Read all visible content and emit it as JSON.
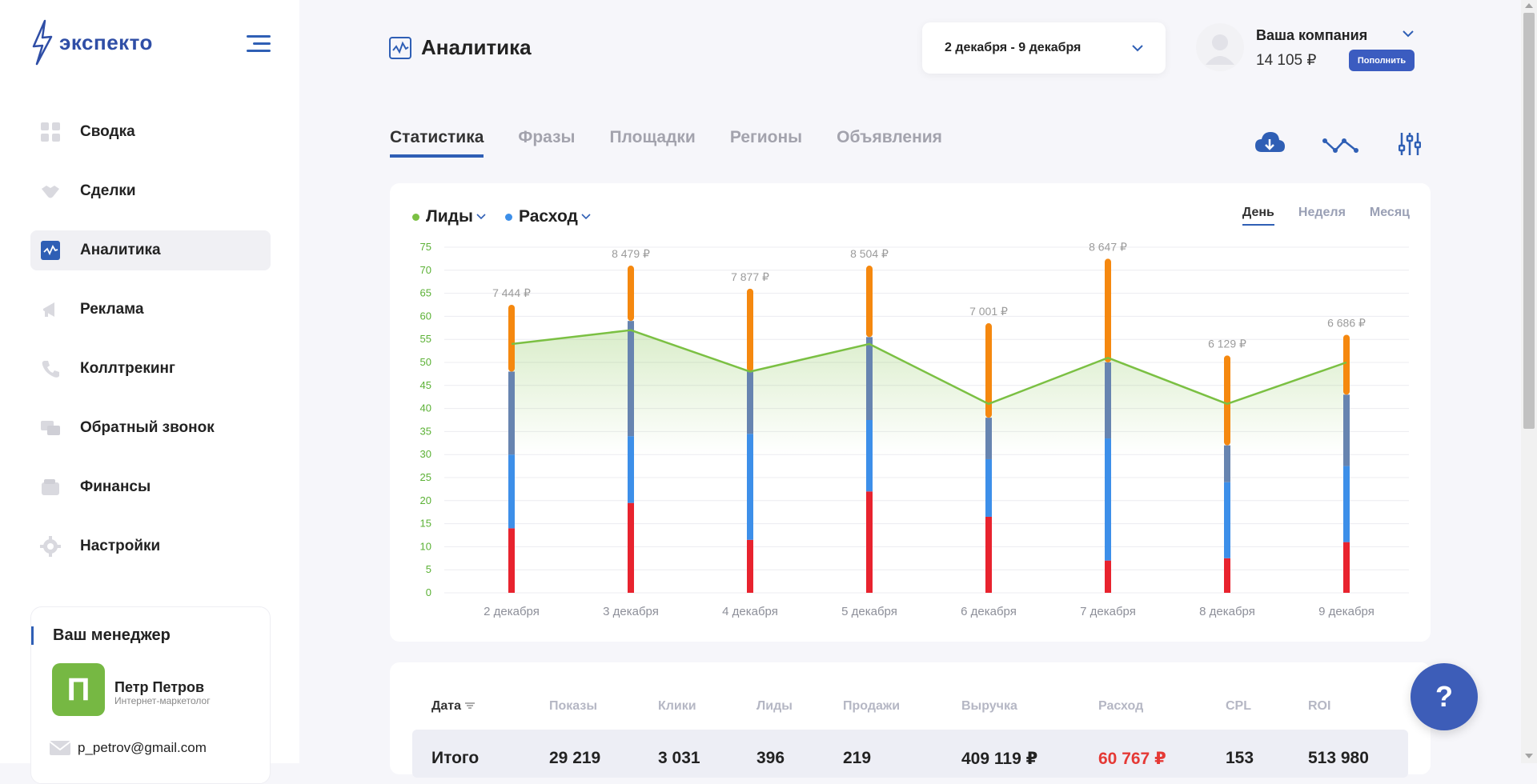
{
  "app": {
    "logo_text": "экспекто"
  },
  "sidebar": {
    "items": [
      {
        "label": "Сводка",
        "icon": "dashboard-icon"
      },
      {
        "label": "Сделки",
        "icon": "handshake-icon"
      },
      {
        "label": "Аналитика",
        "icon": "analytics-icon",
        "active": true
      },
      {
        "label": "Реклама",
        "icon": "megaphone-icon"
      },
      {
        "label": "Коллтрекинг",
        "icon": "phone-icon"
      },
      {
        "label": "Обратный звонок",
        "icon": "callback-icon"
      },
      {
        "label": "Финансы",
        "icon": "wallet-icon"
      },
      {
        "label": "Настройки",
        "icon": "gear-icon"
      }
    ],
    "manager": {
      "title": "Ваш менеджер",
      "initial": "П",
      "name": "Петр Петров",
      "role": "Интернет-маркетолог",
      "email": "p_petrov@gmail.com"
    }
  },
  "header": {
    "title": "Аналитика",
    "date_range": "2 декабря - 9 декабря",
    "company": "Ваша компания",
    "balance": "14 105 ₽",
    "topup_label": "Пополнить"
  },
  "tabs": [
    "Статистика",
    "Фразы",
    "Площадки",
    "Регионы",
    "Объявления"
  ],
  "chart_controls": {
    "metric1": "Лиды",
    "metric2": "Расход",
    "periods": [
      "День",
      "Неделя",
      "Месяц"
    ]
  },
  "colors": {
    "accent": "#2f5fb5",
    "leads_line": "#7bc043",
    "seg_red": "#e8232e",
    "seg_blue": "#3d8fe9",
    "seg_steel": "#6784b0",
    "seg_orange": "#f5880f",
    "axis_label": "#5bb135"
  },
  "chart_data": {
    "type": "bar",
    "ylim": [
      0,
      75
    ],
    "yticks": [
      0,
      5,
      10,
      15,
      20,
      25,
      30,
      35,
      40,
      45,
      50,
      55,
      60,
      65,
      70,
      75
    ],
    "categories": [
      "2 декабря",
      "3 декабря",
      "4 декабря",
      "5 декабря",
      "6 декабря",
      "7 декабря",
      "8 декабря",
      "9 декабря"
    ],
    "stack_boundaries": [
      [
        14,
        30,
        48,
        62.5
      ],
      [
        19.5,
        34,
        59,
        71
      ],
      [
        11.5,
        34.5,
        48,
        66
      ],
      [
        22,
        37.5,
        55.5,
        71
      ],
      [
        16.5,
        29,
        38,
        58.5
      ],
      [
        7,
        33.5,
        50,
        72.5
      ],
      [
        7.5,
        24,
        32,
        51.5
      ],
      [
        11,
        27.5,
        43,
        56
      ]
    ],
    "bar_labels": [
      "7 444 ₽",
      "8 479 ₽",
      "7 877 ₽",
      "8 504 ₽",
      "7 001 ₽",
      "8 647 ₽",
      "6 129 ₽",
      "6 686 ₽"
    ],
    "series": [
      {
        "name": "Лиды",
        "type": "line",
        "values": [
          54,
          57,
          48,
          54,
          41,
          51,
          41,
          50
        ]
      }
    ]
  },
  "table": {
    "headers": [
      "Дата",
      "Показы",
      "Клики",
      "Лиды",
      "Продажи",
      "Выручка",
      "Расход",
      "CPL",
      "ROI"
    ],
    "total": [
      "Итого",
      "29 219",
      "3 031",
      "396",
      "219",
      "409 119 ₽",
      "60 767 ₽",
      "153",
      "513 980"
    ]
  },
  "help_label": "?"
}
